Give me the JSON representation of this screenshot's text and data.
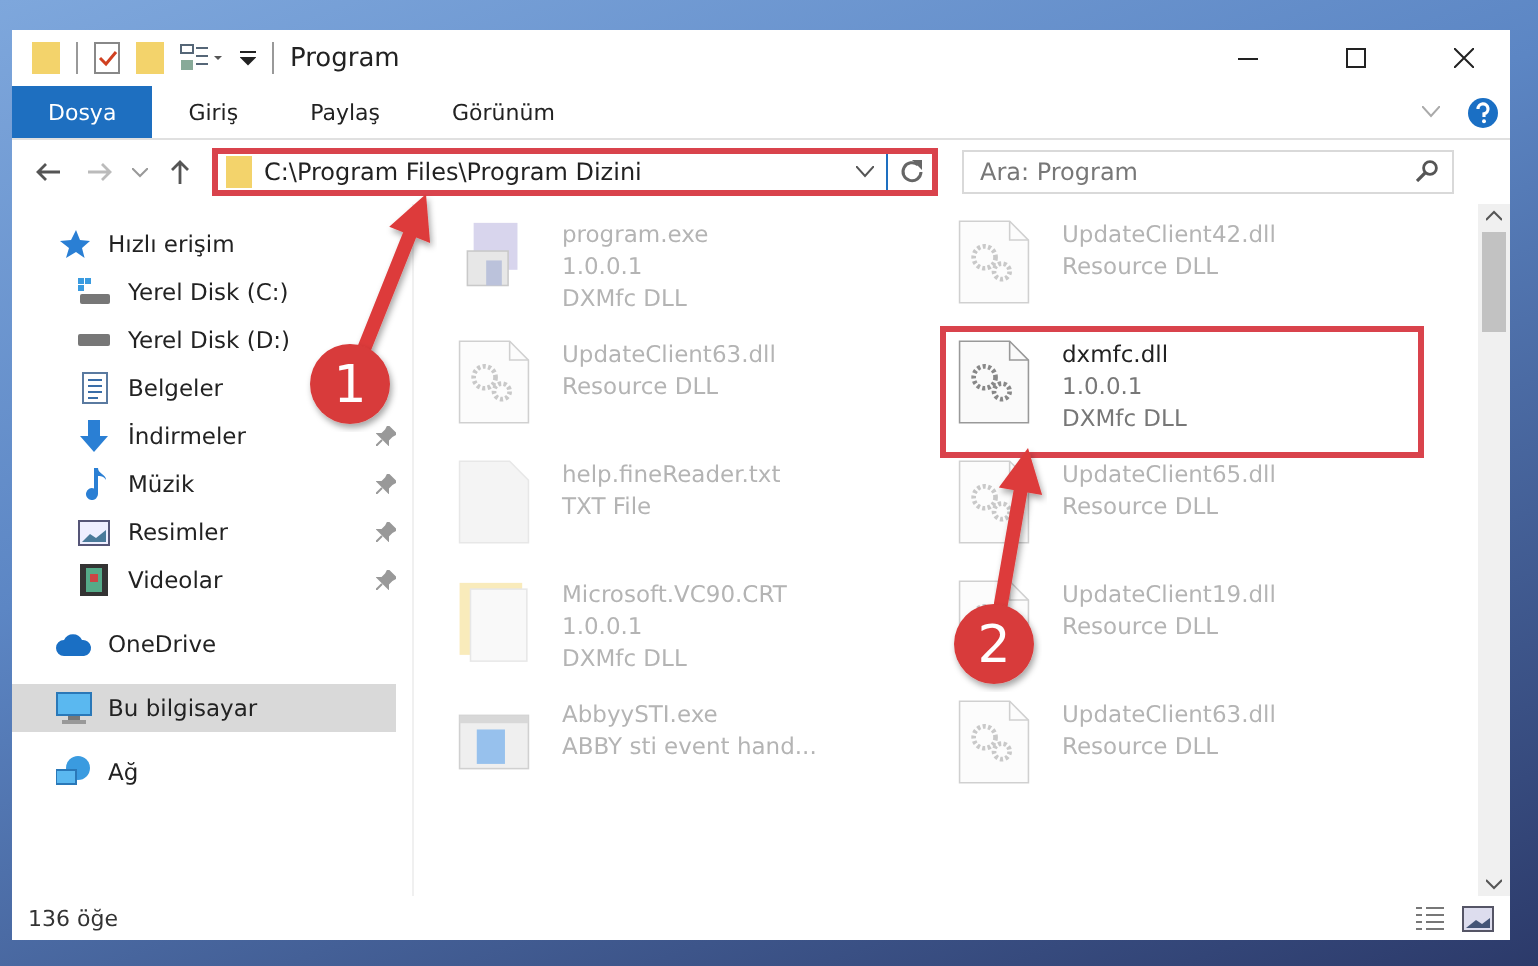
{
  "window": {
    "title": "Program"
  },
  "ribbon_tabs": [
    {
      "label": "Dosya",
      "selected": true
    },
    {
      "label": "Giriş",
      "selected": false
    },
    {
      "label": "Paylaş",
      "selected": false
    },
    {
      "label": "Görünüm",
      "selected": false
    }
  ],
  "address": {
    "path": "C:\\Program Files\\Program Dizini",
    "highlighted": true
  },
  "search": {
    "placeholder": "Ara: Program"
  },
  "sidebar": {
    "items": [
      {
        "label": "Hızlı erişim",
        "kind": "star",
        "selected": false,
        "children": [
          {
            "label": "Yerel Disk (C:)",
            "kind": "drive-c",
            "pinned": false,
            "selected": false
          },
          {
            "label": "Yerel Disk (D:)",
            "kind": "drive",
            "pinned": false,
            "selected": false
          },
          {
            "label": "Belgeler",
            "kind": "docs",
            "pinned": false,
            "selected": false
          },
          {
            "label": "İndirmeler",
            "kind": "download",
            "pinned": true,
            "selected": false
          },
          {
            "label": "Müzik",
            "kind": "music",
            "pinned": true,
            "selected": false
          },
          {
            "label": "Resimler",
            "kind": "pictures",
            "pinned": true,
            "selected": false
          },
          {
            "label": "Videolar",
            "kind": "video",
            "pinned": true,
            "selected": false
          }
        ]
      },
      {
        "label": "OneDrive",
        "kind": "cloud",
        "selected": false
      },
      {
        "label": "Bu bilgisayar",
        "kind": "pc",
        "selected": true
      },
      {
        "label": "Ağ",
        "kind": "network",
        "selected": false
      }
    ]
  },
  "files": [
    {
      "kind": "setup",
      "lines": [
        "program.exe",
        "1.0.0.1",
        "DXMfc DLL"
      ],
      "blurred": true,
      "highlighted": false
    },
    {
      "kind": "dll",
      "lines": [
        "UpdateClient42.dll",
        "Resource DLL"
      ],
      "blurred": true,
      "highlighted": false
    },
    {
      "kind": "dll",
      "lines": [
        "UpdateClient63.dll",
        "Resource DLL"
      ],
      "blurred": true,
      "highlighted": false
    },
    {
      "kind": "dll",
      "lines": [
        "dxmfc.dll",
        "1.0.0.1",
        "DXMfc DLL"
      ],
      "blurred": false,
      "highlighted": true
    },
    {
      "kind": "txt",
      "lines": [
        "help.fineReader.txt",
        "TXT File"
      ],
      "blurred": true,
      "highlighted": false
    },
    {
      "kind": "dll",
      "lines": [
        "UpdateClient65.dll",
        "Resource DLL"
      ],
      "blurred": true,
      "highlighted": false
    },
    {
      "kind": "folder",
      "lines": [
        "Microsoft.VC90.CRT",
        "1.0.0.1",
        "DXMfc DLL"
      ],
      "blurred": true,
      "highlighted": false
    },
    {
      "kind": "dll",
      "lines": [
        "UpdateClient19.dll",
        "Resource DLL"
      ],
      "blurred": true,
      "highlighted": false
    },
    {
      "kind": "app",
      "lines": [
        "AbbyySTI.exe",
        "ABBY sti event hand..."
      ],
      "blurred": true,
      "highlighted": false
    },
    {
      "kind": "dll",
      "lines": [
        "UpdateClient63.dll",
        "Resource DLL"
      ],
      "blurred": true,
      "highlighted": false
    }
  ],
  "annotations": [
    {
      "label": "1"
    },
    {
      "label": "2"
    }
  ],
  "status_bar": {
    "count": "136 öğe"
  }
}
